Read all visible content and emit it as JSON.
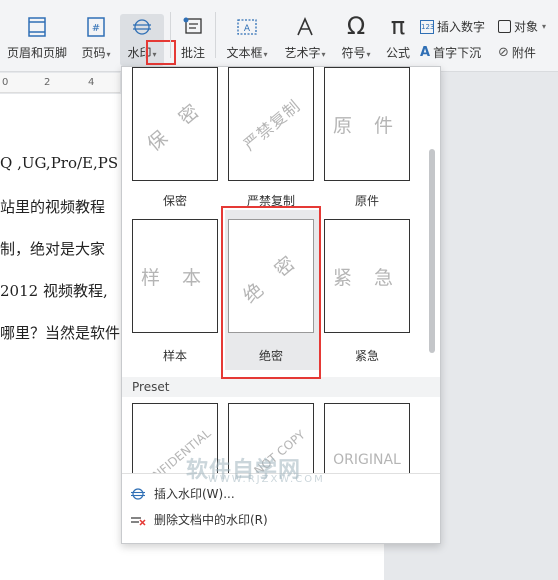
{
  "ribbon": {
    "header_footer": "页眉和页脚",
    "page_number": "页码",
    "watermark": "水印",
    "comment": "批注",
    "textbox": "文本框",
    "wordart": "艺术字",
    "symbol": "符号",
    "formula": "公式",
    "insert_number": "插入数字",
    "object": "对象",
    "drop_cap": "首字下沉",
    "attachment": "附件"
  },
  "ruler": [
    "0",
    "2",
    "4"
  ],
  "document_lines": [
    "Q ,UG,Pro/E,PS",
    "站里的视频教程",
    "制，绝对是大家",
    "2012 视频教程,",
    "哪里？当然是软件"
  ],
  "watermark_panel": {
    "row1": [
      {
        "mark": "保 密",
        "caption": "保密"
      },
      {
        "mark": "严禁复制",
        "caption": "严禁复制"
      },
      {
        "mark": "原 件",
        "caption": "原件"
      }
    ],
    "row2": [
      {
        "mark": "样 本",
        "caption": "样本"
      },
      {
        "mark": "绝 密",
        "caption": "绝密"
      },
      {
        "mark": "紧 急",
        "caption": "紧急"
      }
    ],
    "preset_label": "Preset",
    "row3": [
      {
        "mark": "CONFIDENTIAL"
      },
      {
        "mark": "DO NOT COPY"
      },
      {
        "mark": "ORIGINAL"
      }
    ],
    "insert_watermark": "插入水印(W)...",
    "remove_watermark": "删除文档中的水印(R)"
  },
  "site_watermark": {
    "logo": "软件自学网",
    "url": "WWW.RJZXW.COM"
  },
  "colors": {
    "highlight": "#e53935",
    "accent": "#2f6fb5"
  }
}
